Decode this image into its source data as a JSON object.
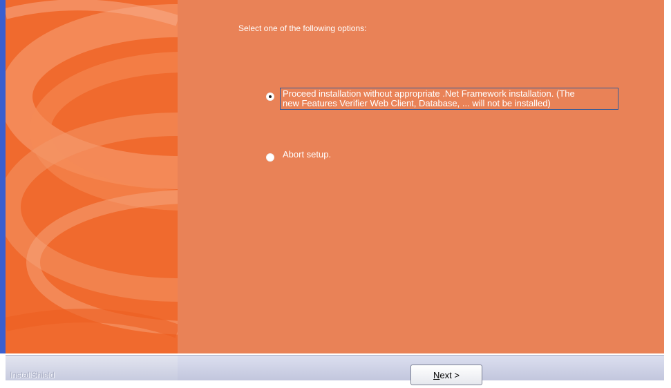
{
  "instruction": "Select one of the following options:",
  "options": [
    {
      "label": "Proceed installation without appropriate .Net Framework installation. (The\nnew Features Verifier Web Client, Database, ... will not be installed)",
      "selected": true
    },
    {
      "label": "Abort setup.",
      "selected": false
    }
  ],
  "footer": {
    "brand": "InstallShield",
    "next_button": {
      "mnemonic": "N",
      "rest": "ext >"
    }
  },
  "colors": {
    "content_background": "#e98257",
    "side_panel_background": "#f06a2e",
    "footer_bar": "#c7cbdf"
  }
}
